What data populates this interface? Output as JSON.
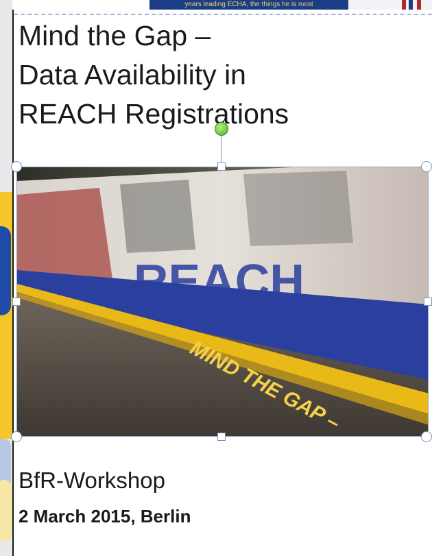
{
  "banner": {
    "text": "years leading ECHA, the things he is most"
  },
  "slide": {
    "title_lines": [
      "Mind the Gap –",
      "Data Availability in",
      "REACH Registrations"
    ],
    "image": {
      "train_text": "REACH",
      "platform_text": "MIND THE GAP –"
    },
    "subtitle": "BfR-Workshop",
    "date_location": "2 March 2015, Berlin"
  },
  "colors": {
    "banner_bg": "#1b3d86",
    "banner_text": "#f2d46a",
    "selection": "#7a93b8",
    "rotate_handle": "#4cae2a",
    "train_blue": "#2b3f9e",
    "platform_yellow": "#e9b918"
  },
  "icons": {
    "rotate_handle": "rotate-handle-icon"
  }
}
